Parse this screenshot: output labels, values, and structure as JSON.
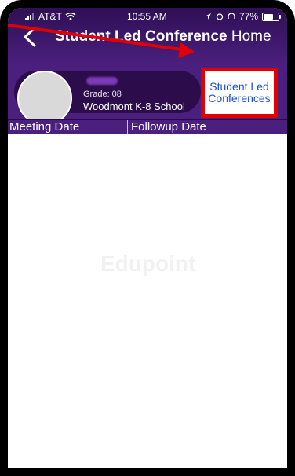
{
  "status_bar": {
    "carrier": "AT&T",
    "time": "10:55 AM",
    "battery": "77%",
    "battery_level": 0.77
  },
  "header": {
    "title_bold": "Student Led Conference",
    "title_rest": "Home"
  },
  "student": {
    "grade": "Grade: 08",
    "school": "Woodmont K-8 School"
  },
  "conferences_button": {
    "line1": "Student Led",
    "line2": "Conferences"
  },
  "table": {
    "columns": [
      "Meeting Date",
      "Followup Date"
    ]
  },
  "watermark": "Edupoint",
  "colors": {
    "header": "#4a1f7e",
    "highlight": "#e00000",
    "link": "#1a4fd6"
  }
}
